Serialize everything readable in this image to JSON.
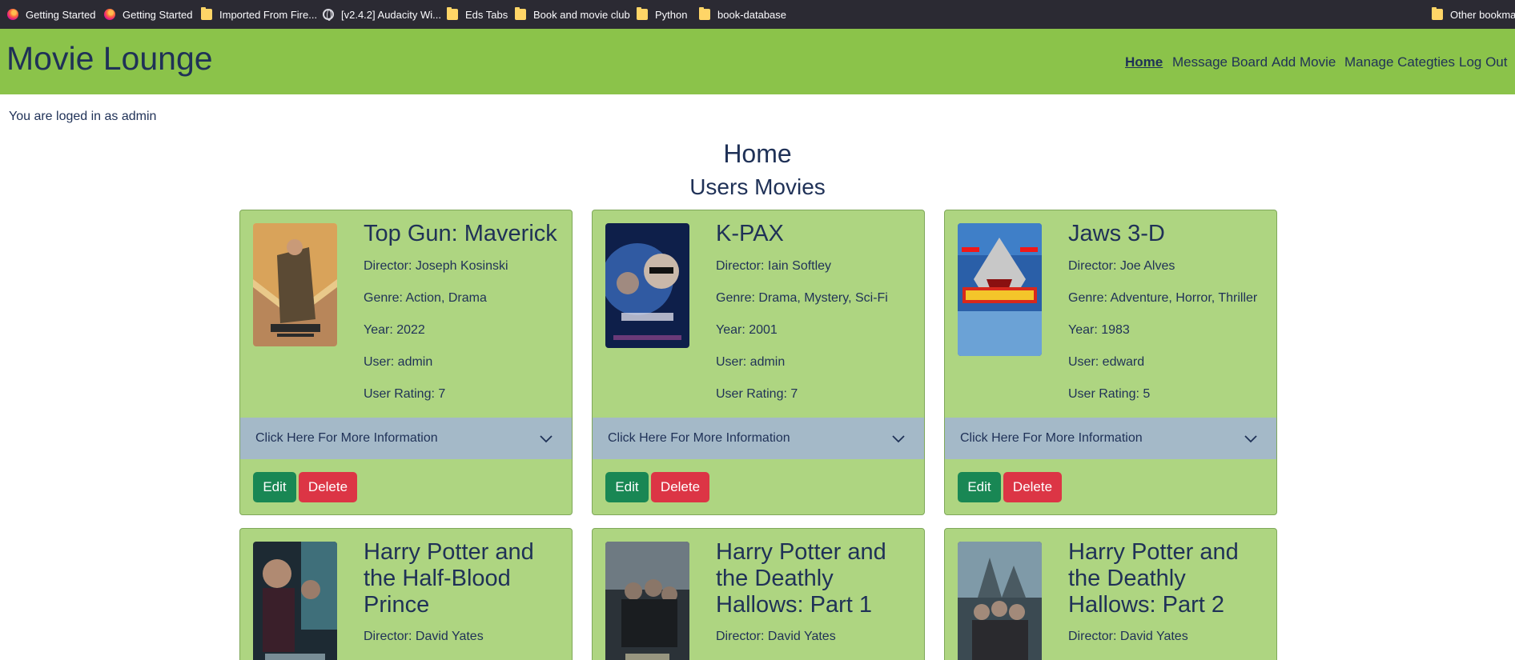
{
  "bookmarks": [
    {
      "label": "Getting Started",
      "icon": "firefox-icon"
    },
    {
      "label": "Getting Started",
      "icon": "firefox-icon"
    },
    {
      "label": "Imported From Fire...",
      "icon": "folder-icon"
    },
    {
      "label": "[v2.4.2] Audacity Wi...",
      "icon": "globe-icon"
    },
    {
      "label": "Eds Tabs",
      "icon": "folder-icon"
    },
    {
      "label": "Book and movie club",
      "icon": "folder-icon"
    },
    {
      "label": "Python",
      "icon": "folder-icon"
    },
    {
      "label": "book-database",
      "icon": "folder-icon"
    },
    {
      "label": "Other bookmarks",
      "icon": "folder-icon"
    }
  ],
  "navbar": {
    "brand": "Movie Lounge",
    "links": [
      "Home",
      "Message Board",
      "Add Movie",
      "Manage Categties",
      "Log Out"
    ],
    "active": "Home"
  },
  "login_status": "You are loged in as admin",
  "headings": {
    "home": "Home",
    "users_movies": "Users Movies"
  },
  "card_common": {
    "more_info": "Click Here For More Information",
    "edit": "Edit",
    "delete": "Delete"
  },
  "movies": [
    {
      "title": "Top Gun: Maverick",
      "director": "Director: Joseph Kosinski",
      "genre": "Genre: Action, Drama",
      "year": "Year: 2022",
      "user": "User: admin",
      "rating": "User Rating: 7"
    },
    {
      "title": "K-PAX",
      "director": "Director: Iain Softley",
      "genre": "Genre: Drama, Mystery, Sci-Fi",
      "year": "Year: 2001",
      "user": "User: admin",
      "rating": "User Rating: 7"
    },
    {
      "title": "Jaws 3-D",
      "director": "Director: Joe Alves",
      "genre": "Genre: Adventure, Horror, Thriller",
      "year": "Year: 1983",
      "user": "User: edward",
      "rating": "User Rating: 5"
    },
    {
      "title": "Harry Potter and the Half-Blood Prince",
      "director": "Director: David Yates"
    },
    {
      "title": "Harry Potter and the Deathly Hallows: Part 1",
      "director": "Director: David Yates"
    },
    {
      "title": "Harry Potter and the Deathly Hallows: Part 2",
      "director": "Director: David Yates"
    }
  ],
  "colors": {
    "navbar": "#8bc34a",
    "card": "#aed581",
    "accordion": "#a4b9c8",
    "edit_button": "#198754",
    "delete_button": "#dc3545",
    "text": "#1f3157"
  }
}
